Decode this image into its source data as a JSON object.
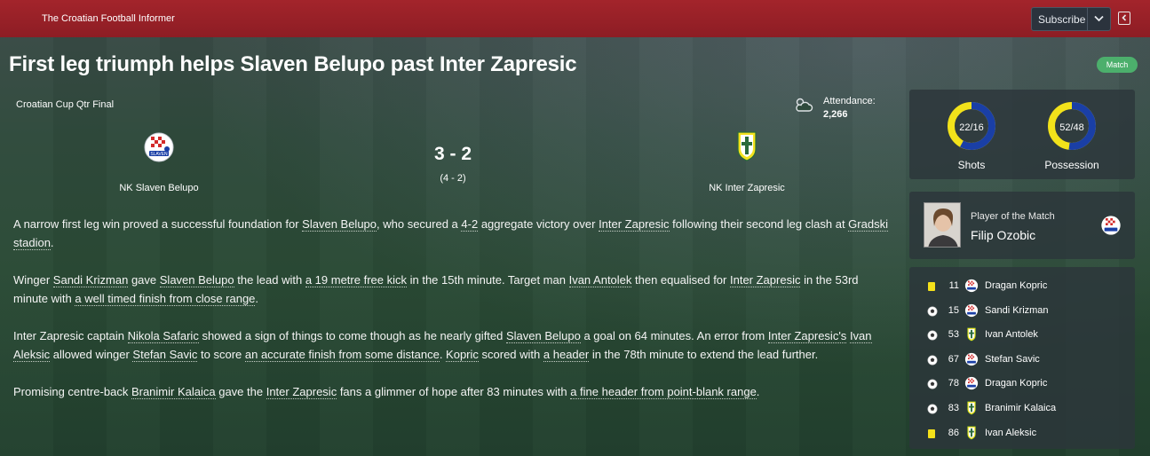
{
  "header": {
    "publication": "The Croatian Football Informer",
    "subscribe_label": "Subscribe"
  },
  "headline": "First leg triumph helps Slaven Belupo past Inter Zapresic",
  "badge": "Match",
  "match": {
    "competition": "Croatian Cup Qtr Final",
    "attendance_label": "Attendance:",
    "attendance_value": "2,266",
    "home_team": "NK Slaven Belupo",
    "away_team": "NK Inter Zapresic",
    "score": "3 - 2",
    "aggregate": "(4 - 2)"
  },
  "article": {
    "p1": [
      {
        "t": "A narrow first leg win proved a successful foundation for "
      },
      {
        "t": "Slaven Belupo",
        "link": true
      },
      {
        "t": ", who secured a "
      },
      {
        "t": "4-2",
        "link": true
      },
      {
        "t": " aggregate victory over "
      },
      {
        "t": "Inter Zapresic",
        "link": true
      },
      {
        "t": " following their second leg clash at "
      },
      {
        "t": "Gradski stadion",
        "link": true
      },
      {
        "t": "."
      }
    ],
    "p2": [
      {
        "t": "Winger "
      },
      {
        "t": "Sandi Krizman",
        "link": true
      },
      {
        "t": " gave "
      },
      {
        "t": "Slaven Belupo",
        "link": true
      },
      {
        "t": " the lead with "
      },
      {
        "t": "a 19 metre free kick",
        "link": true
      },
      {
        "t": " in the 15th minute. Target man "
      },
      {
        "t": "Ivan Antolek",
        "link": true
      },
      {
        "t": " then equalised for "
      },
      {
        "t": "Inter Zapresic",
        "link": true
      },
      {
        "t": " in the 53rd minute with "
      },
      {
        "t": "a well timed finish from close range",
        "link": true
      },
      {
        "t": "."
      }
    ],
    "p3": [
      {
        "t": "Inter Zapresic captain "
      },
      {
        "t": "Nikola Safaric",
        "link": true
      },
      {
        "t": " showed a sign of things to come though as he nearly gifted "
      },
      {
        "t": "Slaven Belupo",
        "link": true
      },
      {
        "t": " a goal on 64 minutes. An error from "
      },
      {
        "t": "Inter Zapresic's",
        "link": true
      },
      {
        "t": " "
      },
      {
        "t": "Ivan Aleksic",
        "link": true
      },
      {
        "t": " allowed winger "
      },
      {
        "t": "Stefan Savic",
        "link": true
      },
      {
        "t": " to score "
      },
      {
        "t": "an accurate finish from some distance",
        "link": true
      },
      {
        "t": ". "
      },
      {
        "t": "Kopric",
        "link": true
      },
      {
        "t": " scored with "
      },
      {
        "t": "a header",
        "link": true
      },
      {
        "t": " in the 78th minute to extend the lead further."
      }
    ],
    "p4": [
      {
        "t": "Promising centre-back "
      },
      {
        "t": "Branimir Kalaica",
        "link": true
      },
      {
        "t": " gave the "
      },
      {
        "t": "Inter Zapresic",
        "link": true
      },
      {
        "t": " fans a glimmer of hope after 83 minutes with "
      },
      {
        "t": "a fine header from point-blank range",
        "link": true
      },
      {
        "t": "."
      }
    ]
  },
  "stats": {
    "shots": {
      "label": "Shots",
      "value": "22/16",
      "home": 22,
      "away": 16
    },
    "possession": {
      "label": "Possession",
      "value": "52/48",
      "home": 52,
      "away": 48
    },
    "home_color": "#1a3fa6",
    "away_color": "#f2e21a"
  },
  "potm": {
    "label": "Player of the Match",
    "name": "Filip Ozobic"
  },
  "events": [
    {
      "type": "yellow-card",
      "minute": "11",
      "team": "home",
      "player": "Dragan Kopric"
    },
    {
      "type": "goal",
      "minute": "15",
      "team": "home",
      "player": "Sandi Krizman"
    },
    {
      "type": "goal",
      "minute": "53",
      "team": "away",
      "player": "Ivan Antolek"
    },
    {
      "type": "goal",
      "minute": "67",
      "team": "home",
      "player": "Stefan Savic"
    },
    {
      "type": "goal",
      "minute": "78",
      "team": "home",
      "player": "Dragan Kopric"
    },
    {
      "type": "goal",
      "minute": "83",
      "team": "away",
      "player": "Branimir Kalaica"
    },
    {
      "type": "yellow-card",
      "minute": "86",
      "team": "away",
      "player": "Ivan Aleksic"
    }
  ]
}
